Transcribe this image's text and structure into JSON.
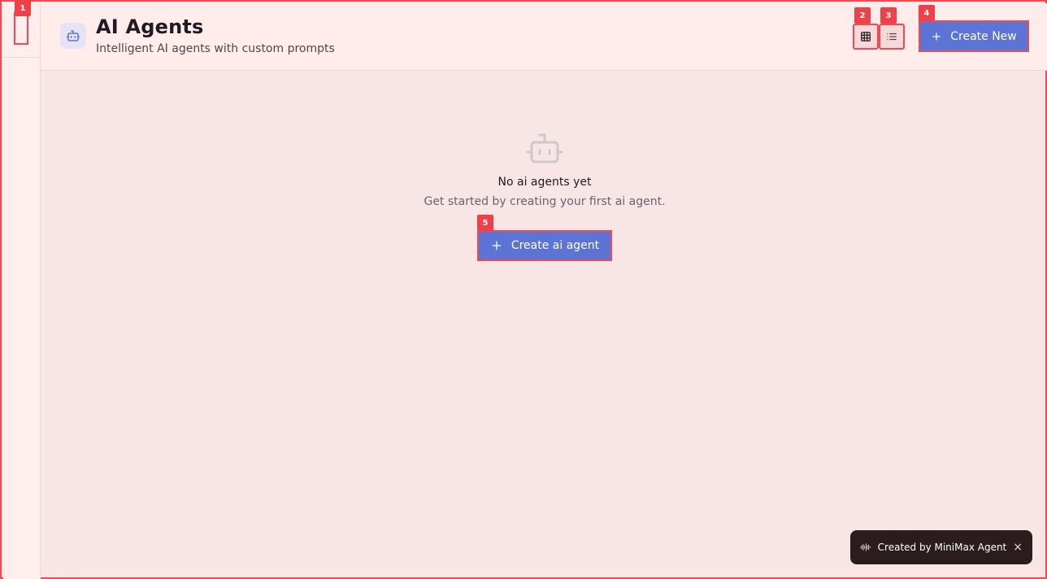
{
  "header": {
    "title": "AI Agents",
    "subtitle": "Intelligent AI agents with custom prompts",
    "icon": "robot-icon",
    "create_new_label": "Create New"
  },
  "view_modes": [
    {
      "name": "grid-view",
      "icon": "grid-icon"
    },
    {
      "name": "list-view",
      "icon": "list-icon"
    }
  ],
  "empty_state": {
    "icon": "robot-icon",
    "title": "No ai agents yet",
    "description": "Get started by creating your first ai agent.",
    "button_label": "Create ai agent"
  },
  "toast": {
    "text": "Created by MiniMax Agent",
    "close_glyph": "×",
    "icon": "waveform-icon"
  },
  "badges": [
    "1",
    "2",
    "3",
    "4",
    "5"
  ],
  "colors": {
    "accent": "#5b74d6",
    "highlight": "#ef4a52",
    "background": "#f8e6e6",
    "toast_bg": "#2b1d1e"
  }
}
